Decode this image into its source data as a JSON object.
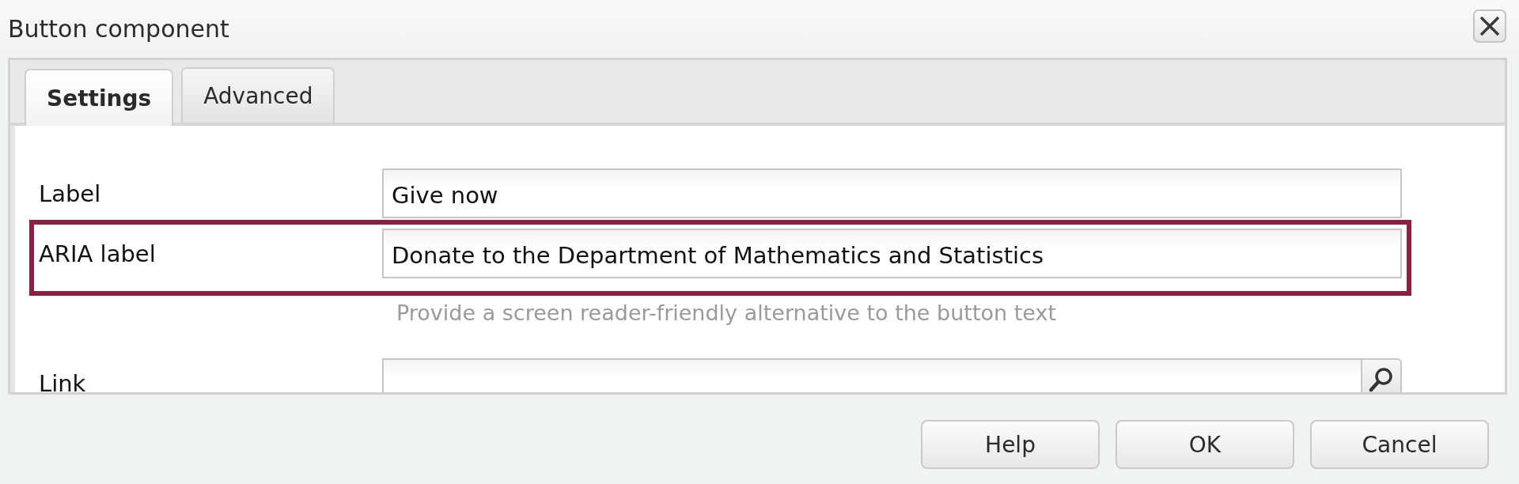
{
  "window": {
    "title": "Button component"
  },
  "tabs": [
    {
      "label": "Settings",
      "selected": true
    },
    {
      "label": "Advanced",
      "selected": false
    }
  ],
  "fields": [
    {
      "kind": "text",
      "label": "Label",
      "value": "Give now",
      "highlighted": false
    },
    {
      "kind": "text",
      "label": "ARIA label",
      "value": "Donate to the Department of Mathematics and Statistics",
      "highlighted": true,
      "help": "Provide a screen reader-friendly alternative to the button text"
    },
    {
      "kind": "search",
      "label": "Link",
      "highlighted": false
    }
  ],
  "buttons": [
    {
      "label": "Help"
    },
    {
      "label": "OK"
    },
    {
      "label": "Cancel"
    }
  ]
}
